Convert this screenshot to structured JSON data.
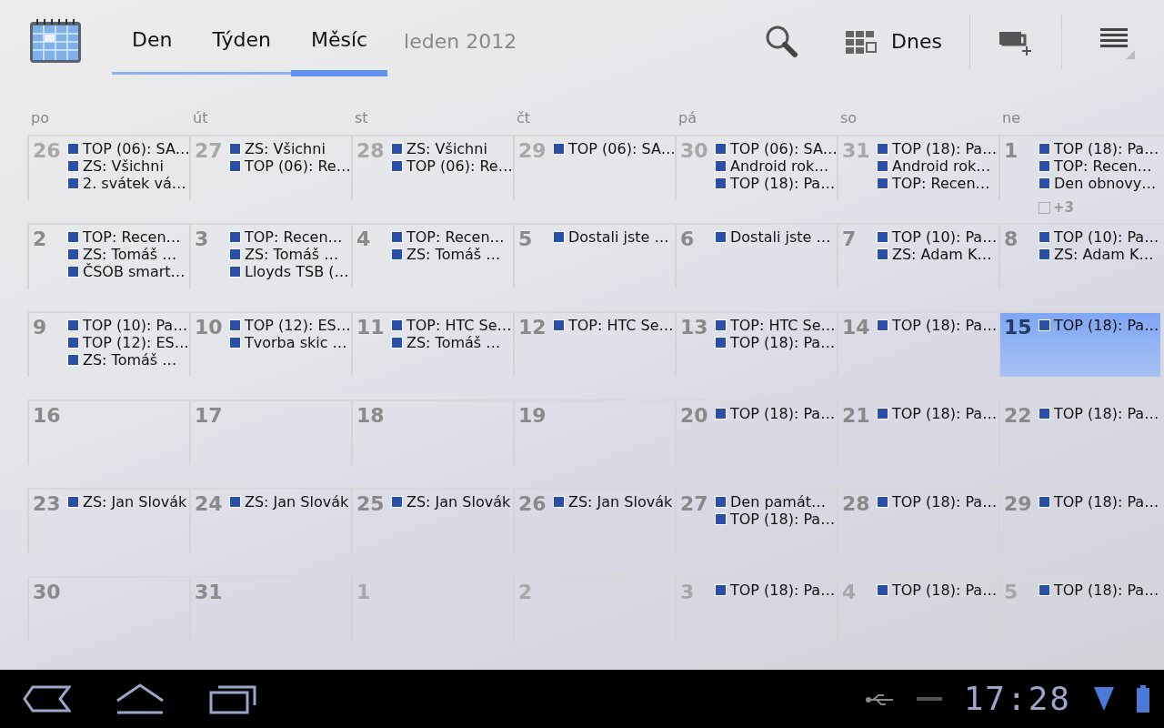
{
  "tabs": [
    {
      "label": "Den",
      "selected": false
    },
    {
      "label": "Týden",
      "selected": false
    },
    {
      "label": "Měsíc",
      "selected": true
    }
  ],
  "month_label": "leden 2012",
  "today_button": "Dnes",
  "weekdays": [
    "po",
    "út",
    "st",
    "čt",
    "pá",
    "so",
    "ne"
  ],
  "weeks": [
    {
      "days": [
        {
          "number": "26",
          "in_month": false,
          "today": false,
          "events": [
            "TOP (06): SA…",
            "ZS: Všichni",
            "2. svátek vá…"
          ]
        },
        {
          "number": "27",
          "in_month": false,
          "today": false,
          "events": [
            "ZS: Všichni",
            "TOP (06): Re…"
          ]
        },
        {
          "number": "28",
          "in_month": false,
          "today": false,
          "events": [
            "ZS: Všichni",
            "TOP (06): Re…"
          ]
        },
        {
          "number": "29",
          "in_month": false,
          "today": false,
          "events": [
            "TOP (06): SA…"
          ]
        },
        {
          "number": "30",
          "in_month": false,
          "today": false,
          "events": [
            "TOP (06): SA…",
            "Android rok…",
            "TOP (18): Pa…"
          ]
        },
        {
          "number": "31",
          "in_month": false,
          "today": false,
          "events": [
            "TOP (18): Pa…",
            "Android rok…",
            "TOP: Recen…"
          ]
        },
        {
          "number": "1",
          "in_month": true,
          "today": false,
          "events": [
            "TOP (18): Pa…",
            "TOP: Recen…",
            "Den obnovy…"
          ],
          "more": "+3"
        }
      ]
    },
    {
      "days": [
        {
          "number": "2",
          "in_month": true,
          "today": false,
          "events": [
            "TOP: Recen…",
            "ZS: Tomáš …",
            "ČSOB smart…"
          ]
        },
        {
          "number": "3",
          "in_month": true,
          "today": false,
          "events": [
            "TOP: Recen…",
            "ZS: Tomáš …",
            "Lloyds TSB (…"
          ]
        },
        {
          "number": "4",
          "in_month": true,
          "today": false,
          "events": [
            "TOP: Recen…",
            "ZS: Tomáš …"
          ]
        },
        {
          "number": "5",
          "in_month": true,
          "today": false,
          "events": [
            "Dostali jste …"
          ]
        },
        {
          "number": "6",
          "in_month": true,
          "today": false,
          "events": [
            "Dostali jste …"
          ]
        },
        {
          "number": "7",
          "in_month": true,
          "today": false,
          "events": [
            "TOP (10): Pa…",
            "ZS: Adam K…"
          ]
        },
        {
          "number": "8",
          "in_month": true,
          "today": false,
          "events": [
            "TOP (10): Pa…",
            "ZS: Adam K…"
          ]
        }
      ]
    },
    {
      "days": [
        {
          "number": "9",
          "in_month": true,
          "today": false,
          "events": [
            "TOP (10): Pa…",
            "TOP (12): ES…",
            "ZS: Tomáš …"
          ]
        },
        {
          "number": "10",
          "in_month": true,
          "today": false,
          "events": [
            "TOP (12): ES…",
            "Tvorba skic …"
          ]
        },
        {
          "number": "11",
          "in_month": true,
          "today": false,
          "events": [
            "TOP: HTC Se…",
            "ZS: Tomáš …"
          ]
        },
        {
          "number": "12",
          "in_month": true,
          "today": false,
          "events": [
            "TOP: HTC Se…"
          ]
        },
        {
          "number": "13",
          "in_month": true,
          "today": false,
          "events": [
            "TOP: HTC Se…",
            "TOP (18): Pa…"
          ]
        },
        {
          "number": "14",
          "in_month": true,
          "today": false,
          "events": [
            "TOP (18): Pa…"
          ]
        },
        {
          "number": "15",
          "in_month": true,
          "today": true,
          "events": [
            "TOP (18): Pa…"
          ]
        }
      ]
    },
    {
      "days": [
        {
          "number": "16",
          "in_month": true,
          "today": false
        },
        {
          "number": "17",
          "in_month": true,
          "today": false
        },
        {
          "number": "18",
          "in_month": true,
          "today": false
        },
        {
          "number": "19",
          "in_month": true,
          "today": false
        },
        {
          "number": "20",
          "in_month": true,
          "today": false,
          "events": [
            "TOP (18): Pa…"
          ]
        },
        {
          "number": "21",
          "in_month": true,
          "today": false,
          "events": [
            "TOP (18): Pa…"
          ]
        },
        {
          "number": "22",
          "in_month": true,
          "today": false,
          "events": [
            "TOP (18): Pa…"
          ]
        }
      ]
    },
    {
      "days": [
        {
          "number": "23",
          "in_month": true,
          "today": false,
          "events": [
            "ZS: Jan Slovák"
          ]
        },
        {
          "number": "24",
          "in_month": true,
          "today": false,
          "events": [
            "ZS: Jan Slovák"
          ]
        },
        {
          "number": "25",
          "in_month": true,
          "today": false,
          "events": [
            "ZS: Jan Slovák"
          ]
        },
        {
          "number": "26",
          "in_month": true,
          "today": false,
          "events": [
            "ZS: Jan Slovák"
          ]
        },
        {
          "number": "27",
          "in_month": true,
          "today": false,
          "events": [
            "Den památ…",
            "TOP (18): Pa…"
          ]
        },
        {
          "number": "28",
          "in_month": true,
          "today": false,
          "events": [
            "TOP (18): Pa…"
          ]
        },
        {
          "number": "29",
          "in_month": true,
          "today": false,
          "events": [
            "TOP (18): Pa…"
          ]
        }
      ]
    },
    {
      "days": [
        {
          "number": "30",
          "in_month": true,
          "today": false
        },
        {
          "number": "31",
          "in_month": true,
          "today": false
        },
        {
          "number": "1",
          "in_month": false,
          "today": false
        },
        {
          "number": "2",
          "in_month": false,
          "today": false
        },
        {
          "number": "3",
          "in_month": false,
          "today": false,
          "events": [
            "TOP (18): Pa…"
          ]
        },
        {
          "number": "4",
          "in_month": false,
          "today": false,
          "events": [
            "TOP (18): Pa…"
          ]
        },
        {
          "number": "5",
          "in_month": false,
          "today": false,
          "events": [
            "TOP (18): Pa…"
          ]
        }
      ]
    }
  ],
  "status_bar": {
    "time": "17:28"
  }
}
